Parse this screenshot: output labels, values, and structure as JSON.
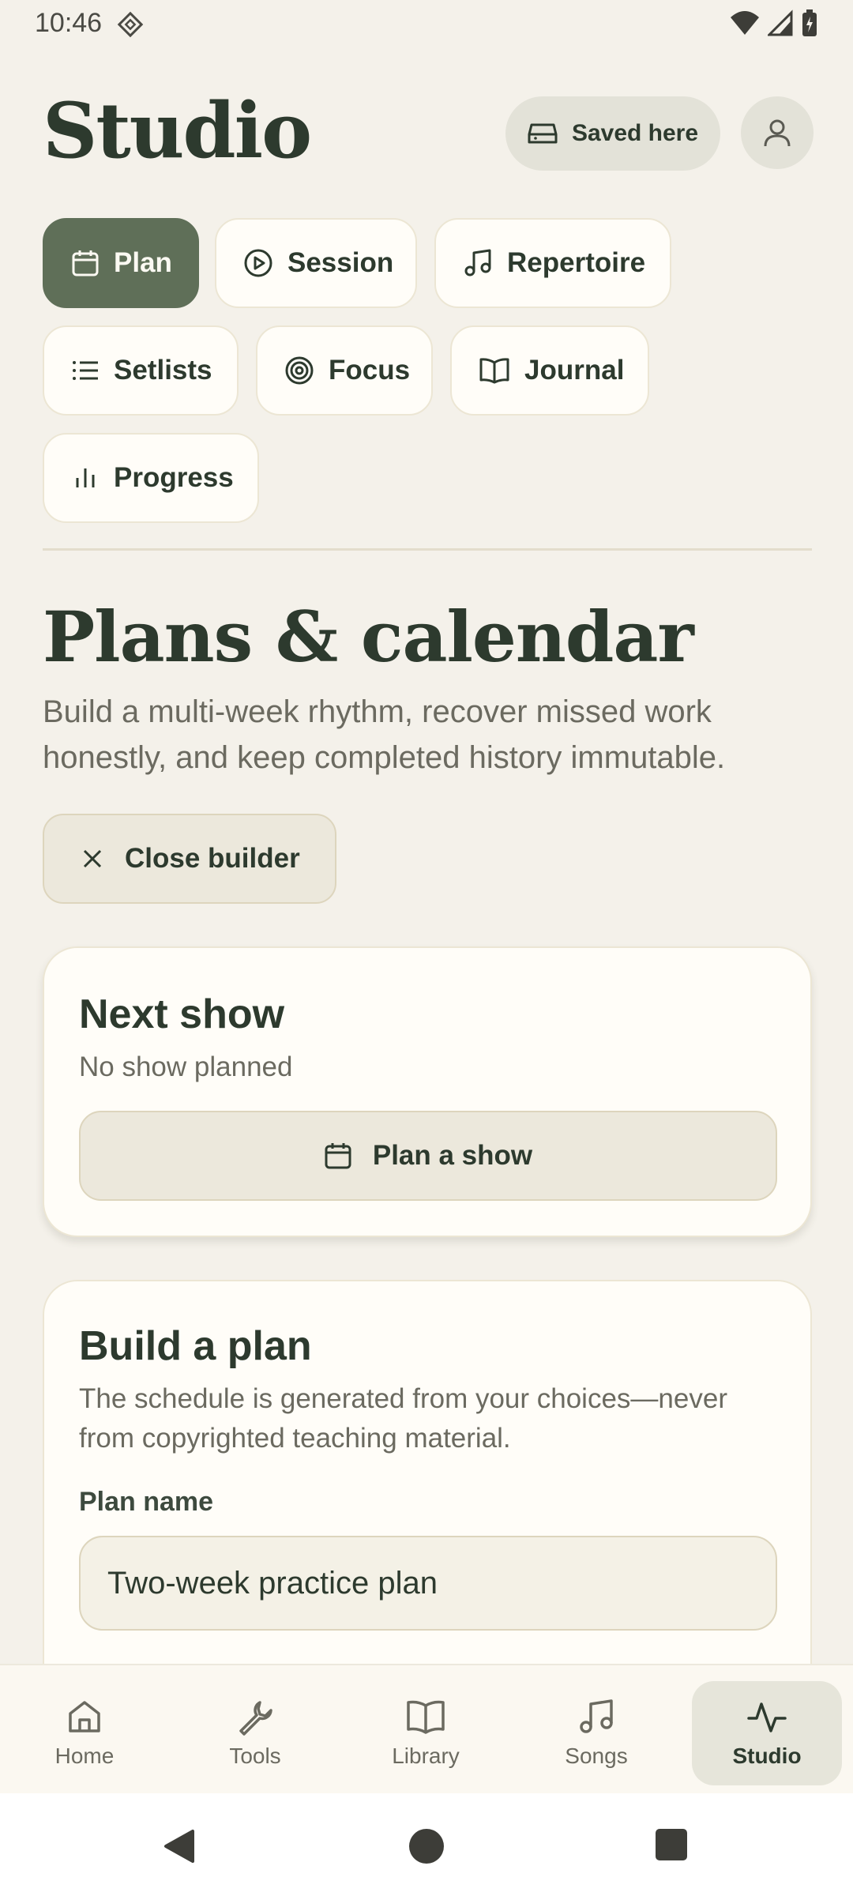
{
  "status_bar": {
    "time": "10:46"
  },
  "header": {
    "title": "Studio",
    "saved_label": "Saved here"
  },
  "tabs": [
    {
      "label": "Plan",
      "icon": "calendar-icon",
      "active": true
    },
    {
      "label": "Session",
      "icon": "play-circle-icon",
      "active": false
    },
    {
      "label": "Repertoire",
      "icon": "music-note-icon",
      "active": false
    },
    {
      "label": "Setlists",
      "icon": "list-icon",
      "active": false
    },
    {
      "label": "Focus",
      "icon": "target-icon",
      "active": false
    },
    {
      "label": "Journal",
      "icon": "book-icon",
      "active": false
    },
    {
      "label": "Progress",
      "icon": "bar-chart-icon",
      "active": false
    }
  ],
  "page": {
    "title": "Plans & calendar",
    "description": "Build a multi-week rhythm, recover missed work honestly, and keep completed history immutable.",
    "close_builder_label": "Close builder"
  },
  "next_show": {
    "title": "Next show",
    "subtitle": "No show planned",
    "button_label": "Plan a show"
  },
  "build_plan": {
    "title": "Build a plan",
    "description": "The schedule is generated from your choices—never from copyrighted teaching material.",
    "plan_name_label": "Plan name",
    "plan_name_value": "Two-week practice plan"
  },
  "bottom_nav": [
    {
      "label": "Home",
      "icon": "home-icon",
      "active": false
    },
    {
      "label": "Tools",
      "icon": "wrench-icon",
      "active": false
    },
    {
      "label": "Library",
      "icon": "book-open-icon",
      "active": false
    },
    {
      "label": "Songs",
      "icon": "music-note-icon",
      "active": false
    },
    {
      "label": "Studio",
      "icon": "activity-icon",
      "active": true
    }
  ],
  "colors": {
    "background": "#f4f1ea",
    "accent": "#5f6f58",
    "text": "#2d3a2e",
    "card": "#fffdf8"
  }
}
